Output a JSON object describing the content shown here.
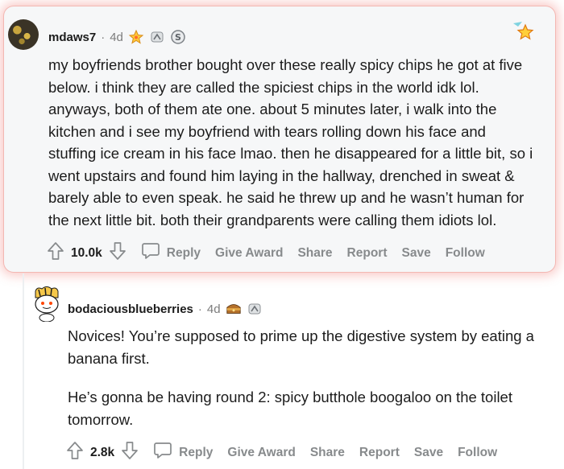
{
  "comments": [
    {
      "username": "mdaws7",
      "separator": "·",
      "age": "4d",
      "body_lines": [
        "my boyfriends brother bought over these really spicy chips he got at five",
        "below. i think they are called the spiciest chips in the world idk lol.",
        "anyways, both of them ate one. about 5 minutes later, i walk into the",
        "kitchen and i see my boyfriend with tears rolling down his face and",
        "stuffing ice cream in his face lmao. then he disappeared for a little bit, so i",
        "went upstairs and found him laying in the hallway, drenched in sweat &",
        "barely able to even speak. he said he threw up and he wasn’t human for",
        "the next little bit. both their grandparents were calling them idiots lol."
      ],
      "score": "10.0k",
      "actions": {
        "reply": "Reply",
        "give_award": "Give Award",
        "share": "Share",
        "report": "Report",
        "save": "Save",
        "follow": "Follow"
      }
    },
    {
      "username": "bodaciousblueberries",
      "separator": "·",
      "age": "4d",
      "paragraph1_lines": [
        "Novices! You’re supposed to prime up the digestive system by eating a",
        "banana first."
      ],
      "paragraph2_lines": [
        "He’s gonna be having round 2: spicy butthole boogaloo on the toilet",
        "tomorrow."
      ],
      "score": "2.8k",
      "actions": {
        "reply": "Reply",
        "give_award": "Give Award",
        "share": "Share",
        "report": "Report",
        "save": "Save",
        "follow": "Follow"
      }
    }
  ],
  "colors": {
    "highlight": "#ec5a50",
    "muted": "#878a8c",
    "text": "#1c1c1c"
  }
}
